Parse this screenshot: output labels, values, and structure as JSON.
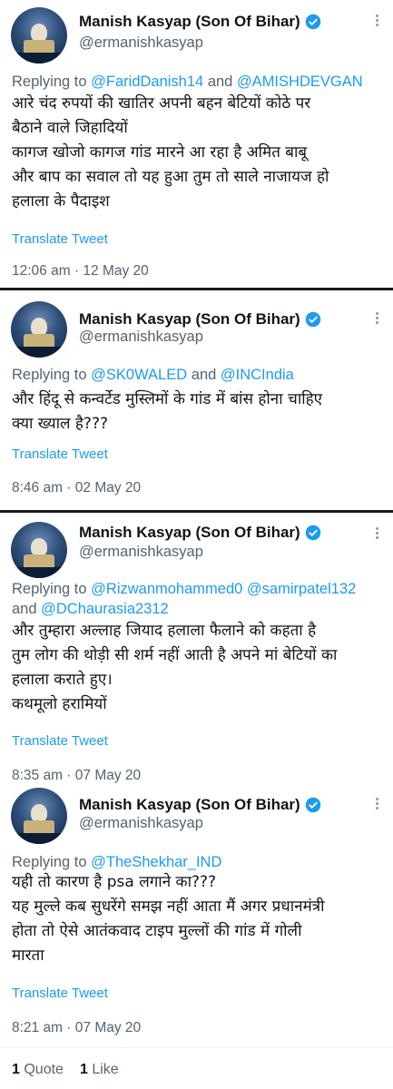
{
  "tweets": [
    {
      "author": {
        "name": "Manish Kasyap (Son Of Bihar)",
        "handle": "@ermanishkasyap",
        "verified": true
      },
      "reply_prefix": "Replying to",
      "reply_to": [
        "@FaridDanish14",
        "and",
        "@AMISHDEVGAN"
      ],
      "lines": [
        "आरे चंद रुपयों की खातिर अपनी बहन बेटियों कोठे पर",
        "बैठाने वाले जिहादियों",
        "कागज खोजो कागज गांड मारने आ रहा है अमित बाबू",
        "और बाप का सवाल तो यह हुआ तुम तो साले नाजायज हो",
        "हलाला के पैदाइश"
      ],
      "translate": "Translate Tweet",
      "time": "12:06 am · 12 May 20"
    },
    {
      "author": {
        "name": "Manish Kasyap (Son Of Bihar)",
        "handle": "@ermanishkasyap",
        "verified": true
      },
      "reply_prefix": "Replying to",
      "reply_to": [
        "@SK0WALED",
        "and",
        "@INCIndia"
      ],
      "lines": [
        "और  हिंदू से कन्वर्टेड मुस्लिमों के गांड में बांस होना चाहिए",
        "क्या ख्याल है???"
      ],
      "translate": "Translate Tweet",
      "time": "8:46 am · 02 May 20"
    },
    {
      "author": {
        "name": "Manish Kasyap (Son Of Bihar)",
        "handle": "@ermanishkasyap",
        "verified": true
      },
      "reply_prefix": "Replying to",
      "reply_to": [
        "@Rizwanmohammed0",
        "@samirpatel132",
        "and",
        "@DChaurasia2312"
      ],
      "lines": [
        "और तुम्हारा अल्लाह जियाद हलाला फैलाने को कहता है",
        "तुम लोग की थोड़ी सी शर्म नहीं आती है अपने मां बेटियों का",
        "हलाला कराते हुए।",
        "कथमूलो हरामियों"
      ],
      "translate": "Translate Tweet",
      "time": "8:35 am · 07 May 20"
    },
    {
      "author": {
        "name": "Manish Kasyap (Son Of Bihar)",
        "handle": "@ermanishkasyap",
        "verified": true
      },
      "reply_prefix": "Replying to",
      "reply_to": [
        "@TheShekhar_IND"
      ],
      "lines": [
        "यही तो कारण है psa लगाने का???",
        "यह मुल्ले कब सुधरेंगे समझ नहीं आता मैं अगर प्रधानमंत्री",
        "होता तो ऐसे आतंकवाद टाइप मुल्लों की गांड में गोली",
        "मारता"
      ],
      "translate": "Translate Tweet",
      "time": "8:21 am · 07 May 20"
    }
  ],
  "stats": {
    "quotes_count": "1",
    "quotes_label": "Quote",
    "likes_count": "1",
    "likes_label": "Like"
  },
  "colors": {
    "link": "#1d9bf0",
    "muted": "#536471",
    "text": "#0f1419",
    "verified": "#1d9bf0"
  },
  "icons": {
    "verified": "verified-badge-icon",
    "more": "more-options-icon"
  }
}
